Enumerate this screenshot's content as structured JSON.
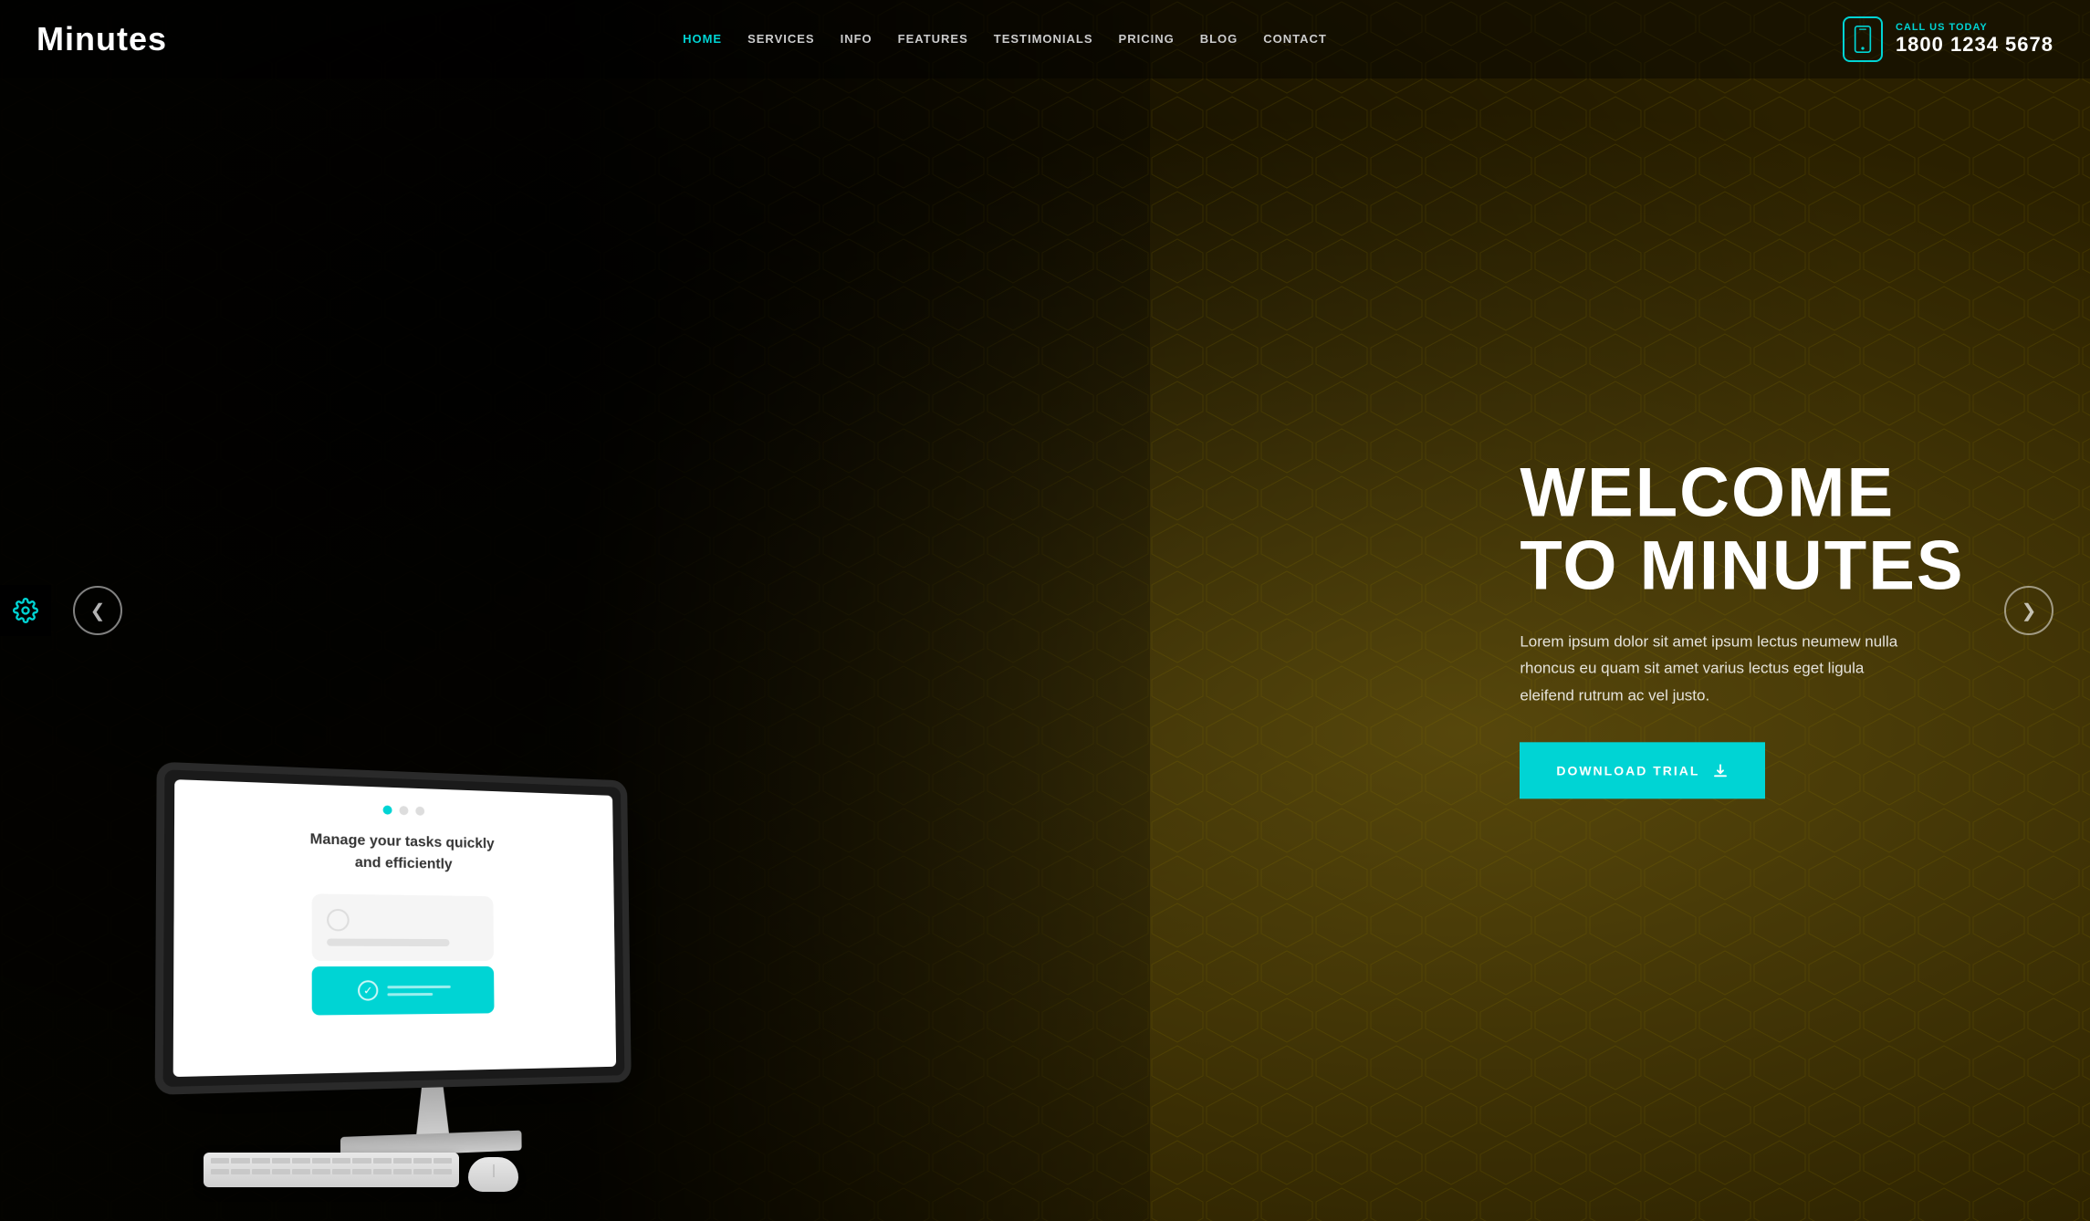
{
  "brand": {
    "logo": "Minutes"
  },
  "navbar": {
    "links": [
      {
        "label": "HOME",
        "active": true
      },
      {
        "label": "SERVICES",
        "active": false
      },
      {
        "label": "INFO",
        "active": false
      },
      {
        "label": "FEATURES",
        "active": false
      },
      {
        "label": "TESTIMONIALS",
        "active": false
      },
      {
        "label": "PRICING",
        "active": false
      },
      {
        "label": "BLOG",
        "active": false
      },
      {
        "label": "CONTACT",
        "active": false
      }
    ],
    "call_label": "CALL US TODAY",
    "call_number": "1800 1234 5678"
  },
  "hero": {
    "title_line1": "WELCOME",
    "title_line2": "TO MINUTES",
    "description": "Lorem ipsum dolor sit amet ipsum lectus neumew nulla rhoncus eu quam sit amet varius lectus eget ligula eleifend\nrutrum ac vel justo.",
    "cta_label": "DOWNLOAD TRIAL"
  },
  "screen": {
    "tagline_line1": "Manage your tasks quickly",
    "tagline_line2": "and efficiently"
  },
  "slider": {
    "prev_arrow": "❮",
    "next_arrow": "❯"
  },
  "colors": {
    "accent": "#00d4d4",
    "dark": "#1a1a1a"
  }
}
